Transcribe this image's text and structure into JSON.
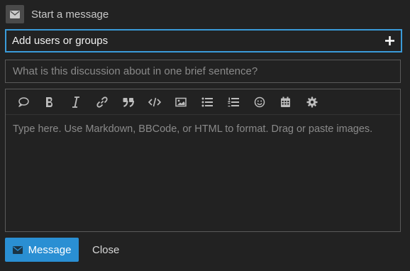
{
  "header": {
    "title": "Start a message",
    "icon": "envelope-icon"
  },
  "users_field": {
    "value": "Add users or groups",
    "action_icon": "plus-icon"
  },
  "title_field": {
    "placeholder": "What is this discussion about in one brief sentence?",
    "value": ""
  },
  "editor": {
    "toolbar": [
      {
        "name": "quote-icon"
      },
      {
        "name": "bold-icon"
      },
      {
        "name": "italic-icon"
      },
      {
        "name": "link-icon"
      },
      {
        "name": "blockquote-icon"
      },
      {
        "name": "code-icon"
      },
      {
        "name": "image-icon"
      },
      {
        "name": "bullet-list-icon"
      },
      {
        "name": "numbered-list-icon"
      },
      {
        "name": "emoji-icon"
      },
      {
        "name": "calendar-icon"
      },
      {
        "name": "gear-icon"
      }
    ],
    "placeholder": "Type here. Use Markdown, BBCode, or HTML to format. Drag or paste images."
  },
  "footer": {
    "send_label": "Message",
    "send_icon": "envelope-icon",
    "close_label": "Close"
  },
  "colors": {
    "background": "#222222",
    "accent": "#2a8fd3",
    "focus_border": "#3a9bd9",
    "border": "#5a5a5a",
    "icon": "#bdbdbd"
  }
}
